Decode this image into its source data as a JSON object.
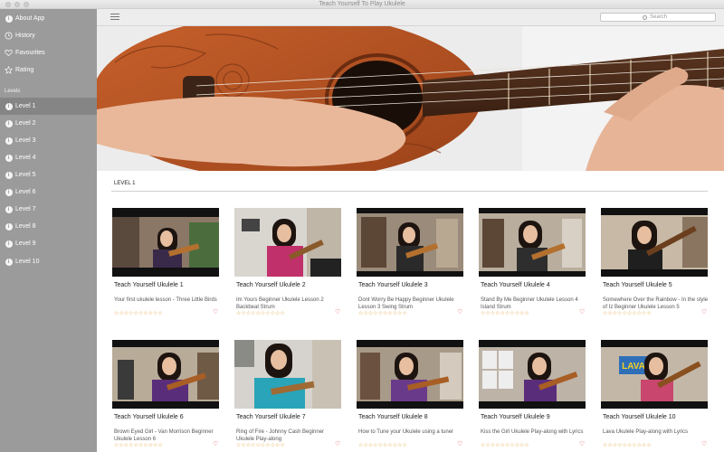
{
  "window": {
    "title": "Teach Yourself To Play Ukulele"
  },
  "sidebar": {
    "top_items": [
      {
        "label": "About App",
        "icon": "info-icon"
      },
      {
        "label": "History",
        "icon": "clock-icon"
      },
      {
        "label": "Favourites",
        "icon": "heart-icon"
      },
      {
        "label": "Rating",
        "icon": "star-icon"
      }
    ],
    "section_header": "Levels",
    "levels": [
      {
        "label": "Level 1",
        "active": true
      },
      {
        "label": "Level 2"
      },
      {
        "label": "Level 3"
      },
      {
        "label": "Level 4"
      },
      {
        "label": "Level 5"
      },
      {
        "label": "Level 6"
      },
      {
        "label": "Level 7"
      },
      {
        "label": "Level 8"
      },
      {
        "label": "Level 9"
      },
      {
        "label": "Level 10"
      }
    ]
  },
  "toolbar": {
    "search_placeholder": "Search"
  },
  "main": {
    "section_title": "LEVEL 1",
    "videos": [
      {
        "title": "Teach Yourself Ukulele 1",
        "desc": "Your first ukulele lesson - Three Little Birds",
        "rating": 0
      },
      {
        "title": "Teach Yourself Ukulele 2",
        "desc": "Im Yours  Beginner Ukulele Lesson 2 Backbeat Strum",
        "rating": 0
      },
      {
        "title": "Teach Yourself Ukulele 3",
        "desc": "Dont Worry Be Happy  Beginner Ukulele Lesson 3 Swing Strum",
        "rating": 0
      },
      {
        "title": "Teach Yourself Ukulele 4",
        "desc": "Stand By Me  Beginner Ukulele Lesson 4 Island Strum",
        "rating": 0
      },
      {
        "title": "Teach Yourself Ukulele 5",
        "desc": "Somewhere Over the Rainbow - In the style of Iz Beginner Ukulele Lesson 5",
        "rating": 0
      },
      {
        "title": "Teach Yourself Ukulele 6",
        "desc": "Brown Eyed Girl - Van Morrison  Beginner Ukulele Lesson 6",
        "rating": 0
      },
      {
        "title": "Teach Yourself Ukulele 7",
        "desc": "Ring of Fire - Johnny Cash  Beginner Ukulele Play-along",
        "rating": 0
      },
      {
        "title": "Teach Yourself Ukulele 8",
        "desc": "How to Tune your Ukulele using a tuner",
        "rating": 0
      },
      {
        "title": "Teach Yourself Ukulele 9",
        "desc": "Kiss the Girl Ukulele Play-along with Lyrics",
        "rating": 0
      },
      {
        "title": "Teach Yourself Ukulele 10",
        "desc": "Lava Ukulele Play-along with Lyrics",
        "rating": 0
      }
    ],
    "thumb_signs": {
      "video_10": "LAVA"
    }
  },
  "colors": {
    "sidebar_bg": "#9b9b9b",
    "sidebar_active": "#858585",
    "star_color": "#e2a23c",
    "heart_color": "#e0444c"
  }
}
